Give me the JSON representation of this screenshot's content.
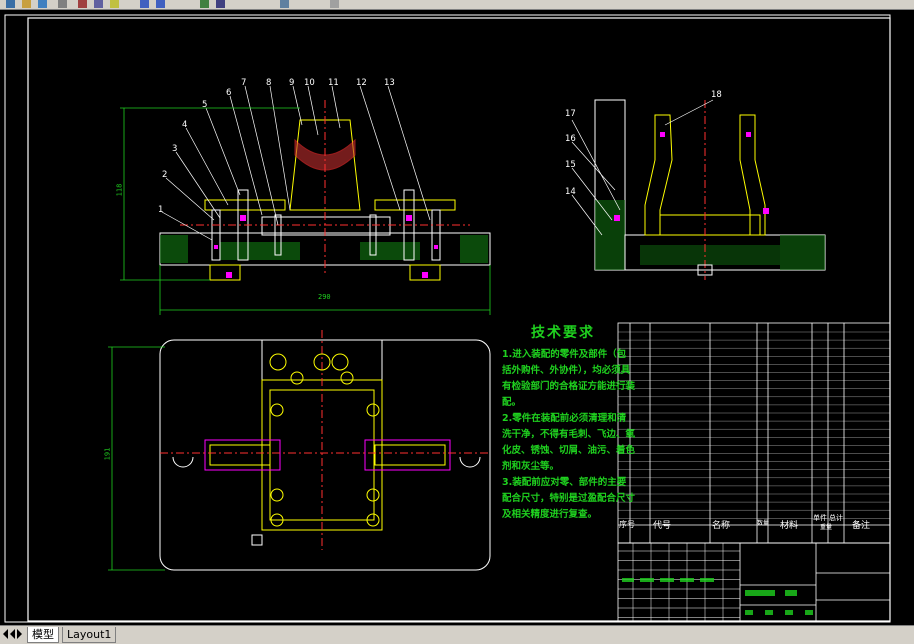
{
  "tabs": [
    {
      "label": "模型",
      "active": true
    },
    {
      "label": "Layout1",
      "active": false
    }
  ],
  "balloons": [
    "1",
    "2",
    "3",
    "4",
    "5",
    "6",
    "7",
    "8",
    "9",
    "10",
    "11",
    "12",
    "13",
    "14",
    "15",
    "16",
    "17",
    "18"
  ],
  "dimensions": {
    "height": "118",
    "width": "290",
    "plan_height": "191"
  },
  "technical_requirements": {
    "title": "技术要求",
    "lines": [
      "1.进入装配的零件及部件（包",
      "括外购件、外协件），均必须具",
      "有检验部门的合格证方能进行装",
      "配。",
      "2.零件在装配前必须清理和清",
      "洗干净，不得有毛刺、飞边、氧",
      "化皮、锈蚀、切屑、油污、着色",
      "剂和灰尘等。",
      "3.装配前应对零、部件的主要",
      "配合尺寸，特别是过盈配合尺寸",
      "及相关精度进行复查。"
    ]
  },
  "title_block": {
    "headers": {
      "seq": "序号",
      "code": "代号",
      "name": "名称",
      "qty": "数量",
      "material": "材料",
      "unit_weight": "单件",
      "total_weight": "总计",
      "weight": "重量",
      "remark": "备注"
    }
  },
  "colors": {
    "background": "#000000",
    "outline": "#ffffff",
    "green": "#1fd11f",
    "yellow": "#ffff00",
    "magenta": "#ff00ff",
    "red": "#ff3030",
    "cyan": "#00ffff"
  }
}
